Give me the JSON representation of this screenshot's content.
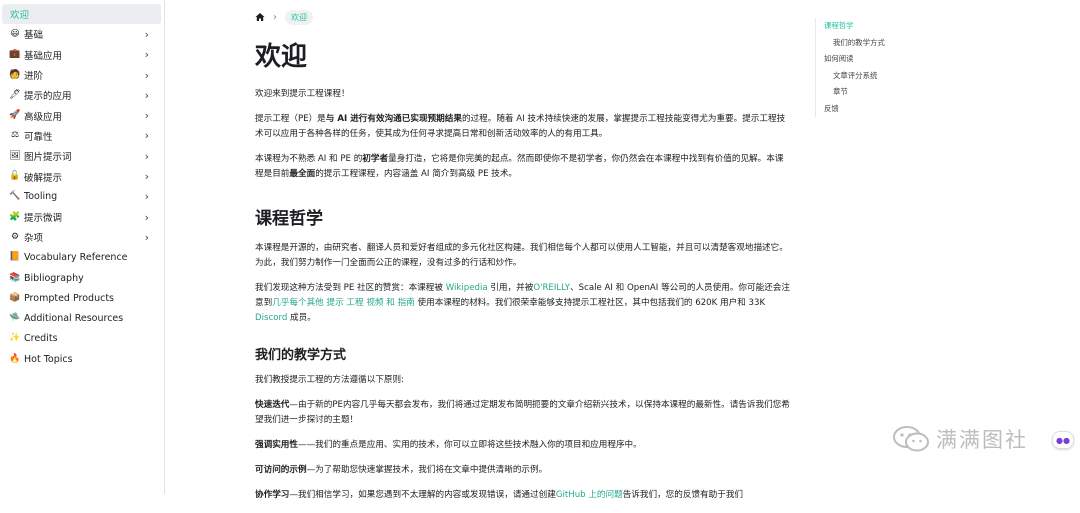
{
  "sidebar": {
    "items": [
      {
        "label": "欢迎",
        "icon": "none",
        "chevron": false,
        "active": true
      },
      {
        "label": "基础",
        "icon": "smiley-icon",
        "glyph": "😃",
        "chevron": true
      },
      {
        "label": "基础应用",
        "icon": "briefcase-icon",
        "glyph": "💼",
        "chevron": true
      },
      {
        "label": "进阶",
        "icon": "technologist-icon",
        "glyph": "🧑",
        "chevron": true
      },
      {
        "label": "提示的应用",
        "icon": "pen-icon",
        "glyph": "🖊",
        "chevron": true
      },
      {
        "label": "高级应用",
        "icon": "rocket-icon",
        "glyph": "🚀",
        "chevron": true
      },
      {
        "label": "可靠性",
        "icon": "scales-icon",
        "glyph": "⚖",
        "chevron": true
      },
      {
        "label": "图片提示词",
        "icon": "picture-icon",
        "glyph": "🖼",
        "chevron": true
      },
      {
        "label": "破解提示",
        "icon": "unlock-icon",
        "glyph": "🔓",
        "chevron": true
      },
      {
        "label": "Tooling",
        "icon": "hammer-icon",
        "glyph": "🔨",
        "chevron": true
      },
      {
        "label": "提示微调",
        "icon": "puzzle-icon",
        "glyph": "🧩",
        "chevron": true
      },
      {
        "label": "杂项",
        "icon": "gear-icon",
        "glyph": "⚙",
        "chevron": true
      },
      {
        "label": "Vocabulary Reference",
        "icon": "book-icon",
        "glyph": "📙",
        "chevron": false
      },
      {
        "label": "Bibliography",
        "icon": "books-icon",
        "glyph": "📚",
        "chevron": false
      },
      {
        "label": "Prompted Products",
        "icon": "package-icon",
        "glyph": "📦",
        "chevron": false
      },
      {
        "label": "Additional Resources",
        "icon": "ship-icon",
        "glyph": "🛸",
        "chevron": false
      },
      {
        "label": "Credits",
        "icon": "sparkle-icon",
        "glyph": "✨",
        "chevron": false
      },
      {
        "label": "Hot Topics",
        "icon": "fire-icon",
        "glyph": "🔥",
        "chevron": false
      }
    ]
  },
  "breadcrumb": {
    "current": "欢迎"
  },
  "main": {
    "title": "欢迎",
    "intro": "欢迎来到提示工程课程！",
    "p1_a": "提示工程（PE）是",
    "p1_b": "与 AI 进行有效沟通已实现预期结果",
    "p1_c": "的过程。随着 AI 技术持续快速的发展，掌握提示工程技能变得尤为重要。提示工程技术可以应用于各种各样的任务，使其成为任何寻求提高日常和创新活动效率的人的有用工具。",
    "p2_a": "本课程为不熟悉 AI 和 PE 的",
    "p2_b": "初学者",
    "p2_c": "量身打造，它将是你完美的起点。然而即使你不是初学者，你仍然会在本课程中找到有价值的见解。本课程是目前",
    "p2_d": "最全面",
    "p2_e": "的提示工程课程，内容涵盖 AI 简介到高级 PE 技术。",
    "h_philosophy": "课程哲学",
    "p3": "本课程是开源的，由研究者、翻译人员和爱好者组成的多元化社区构建。我们相信每个人都可以使用人工智能，并且可以清楚客观地描述它。为此，我们努力制作一门全面而公正的课程，没有过多的行话和炒作。",
    "p4_a": "我们发现这种方法受到 PE 社区的赞赏：本课程被 ",
    "p4_wiki": "Wikipedia",
    "p4_b": " 引用，并被",
    "p4_oreilly": "O'REILLY",
    "p4_c": "、Scale AI 和 OpenAI 等公司的人员使用。你可能还会注意到",
    "p4_links": "几乎每个其他 提示 工程 视频 和 指南",
    "p4_d": " 使用本课程的材料。我们很荣幸能够支持提示工程社区，其中包括我们的 620K 用户和 33K ",
    "p4_discord": "Discord",
    "p4_e": " 成员。",
    "h_teaching": "我们的教学方式",
    "p5": "我们教授提示工程的方法遵循以下原则:",
    "p6_b": "快速迭代",
    "p6": "—由于新的PE内容几乎每天都会发布，我们将通过定期发布简明扼要的文章介绍新兴技术，以保持本课程的最新性。请告诉我们您希望我们进一步探讨的主题！",
    "p7_b": "强调实用性",
    "p7": "——我们的重点是应用、实用的技术，你可以立即将这些技术融入你的项目和应用程序中。",
    "p8_b": "可访问的示例",
    "p8": "—为了帮助您快速掌握技术，我们将在文章中提供清晰的示例。",
    "p9_b": "协作学习",
    "p9_a": "—我们相信学习，如果您遇到不太理解的内容或发现错误，请通过创建",
    "p9_link": "GitHub 上的问题",
    "p9_c": "告诉我们，您的反馈有助于我们"
  },
  "toc": {
    "items": [
      {
        "label": "课程哲学",
        "active": true,
        "sub": false
      },
      {
        "label": "我们的教学方式",
        "active": false,
        "sub": true
      },
      {
        "label": "如何阅读",
        "active": false,
        "sub": false
      },
      {
        "label": "文章评分系统",
        "active": false,
        "sub": true
      },
      {
        "label": "章节",
        "active": false,
        "sub": true
      },
      {
        "label": "反馈",
        "active": false,
        "sub": false
      }
    ]
  },
  "watermark": {
    "text": "满满图社"
  },
  "colors": {
    "accent": "#25c2a0",
    "link": "#25a98a",
    "text": "#1c1e21"
  }
}
